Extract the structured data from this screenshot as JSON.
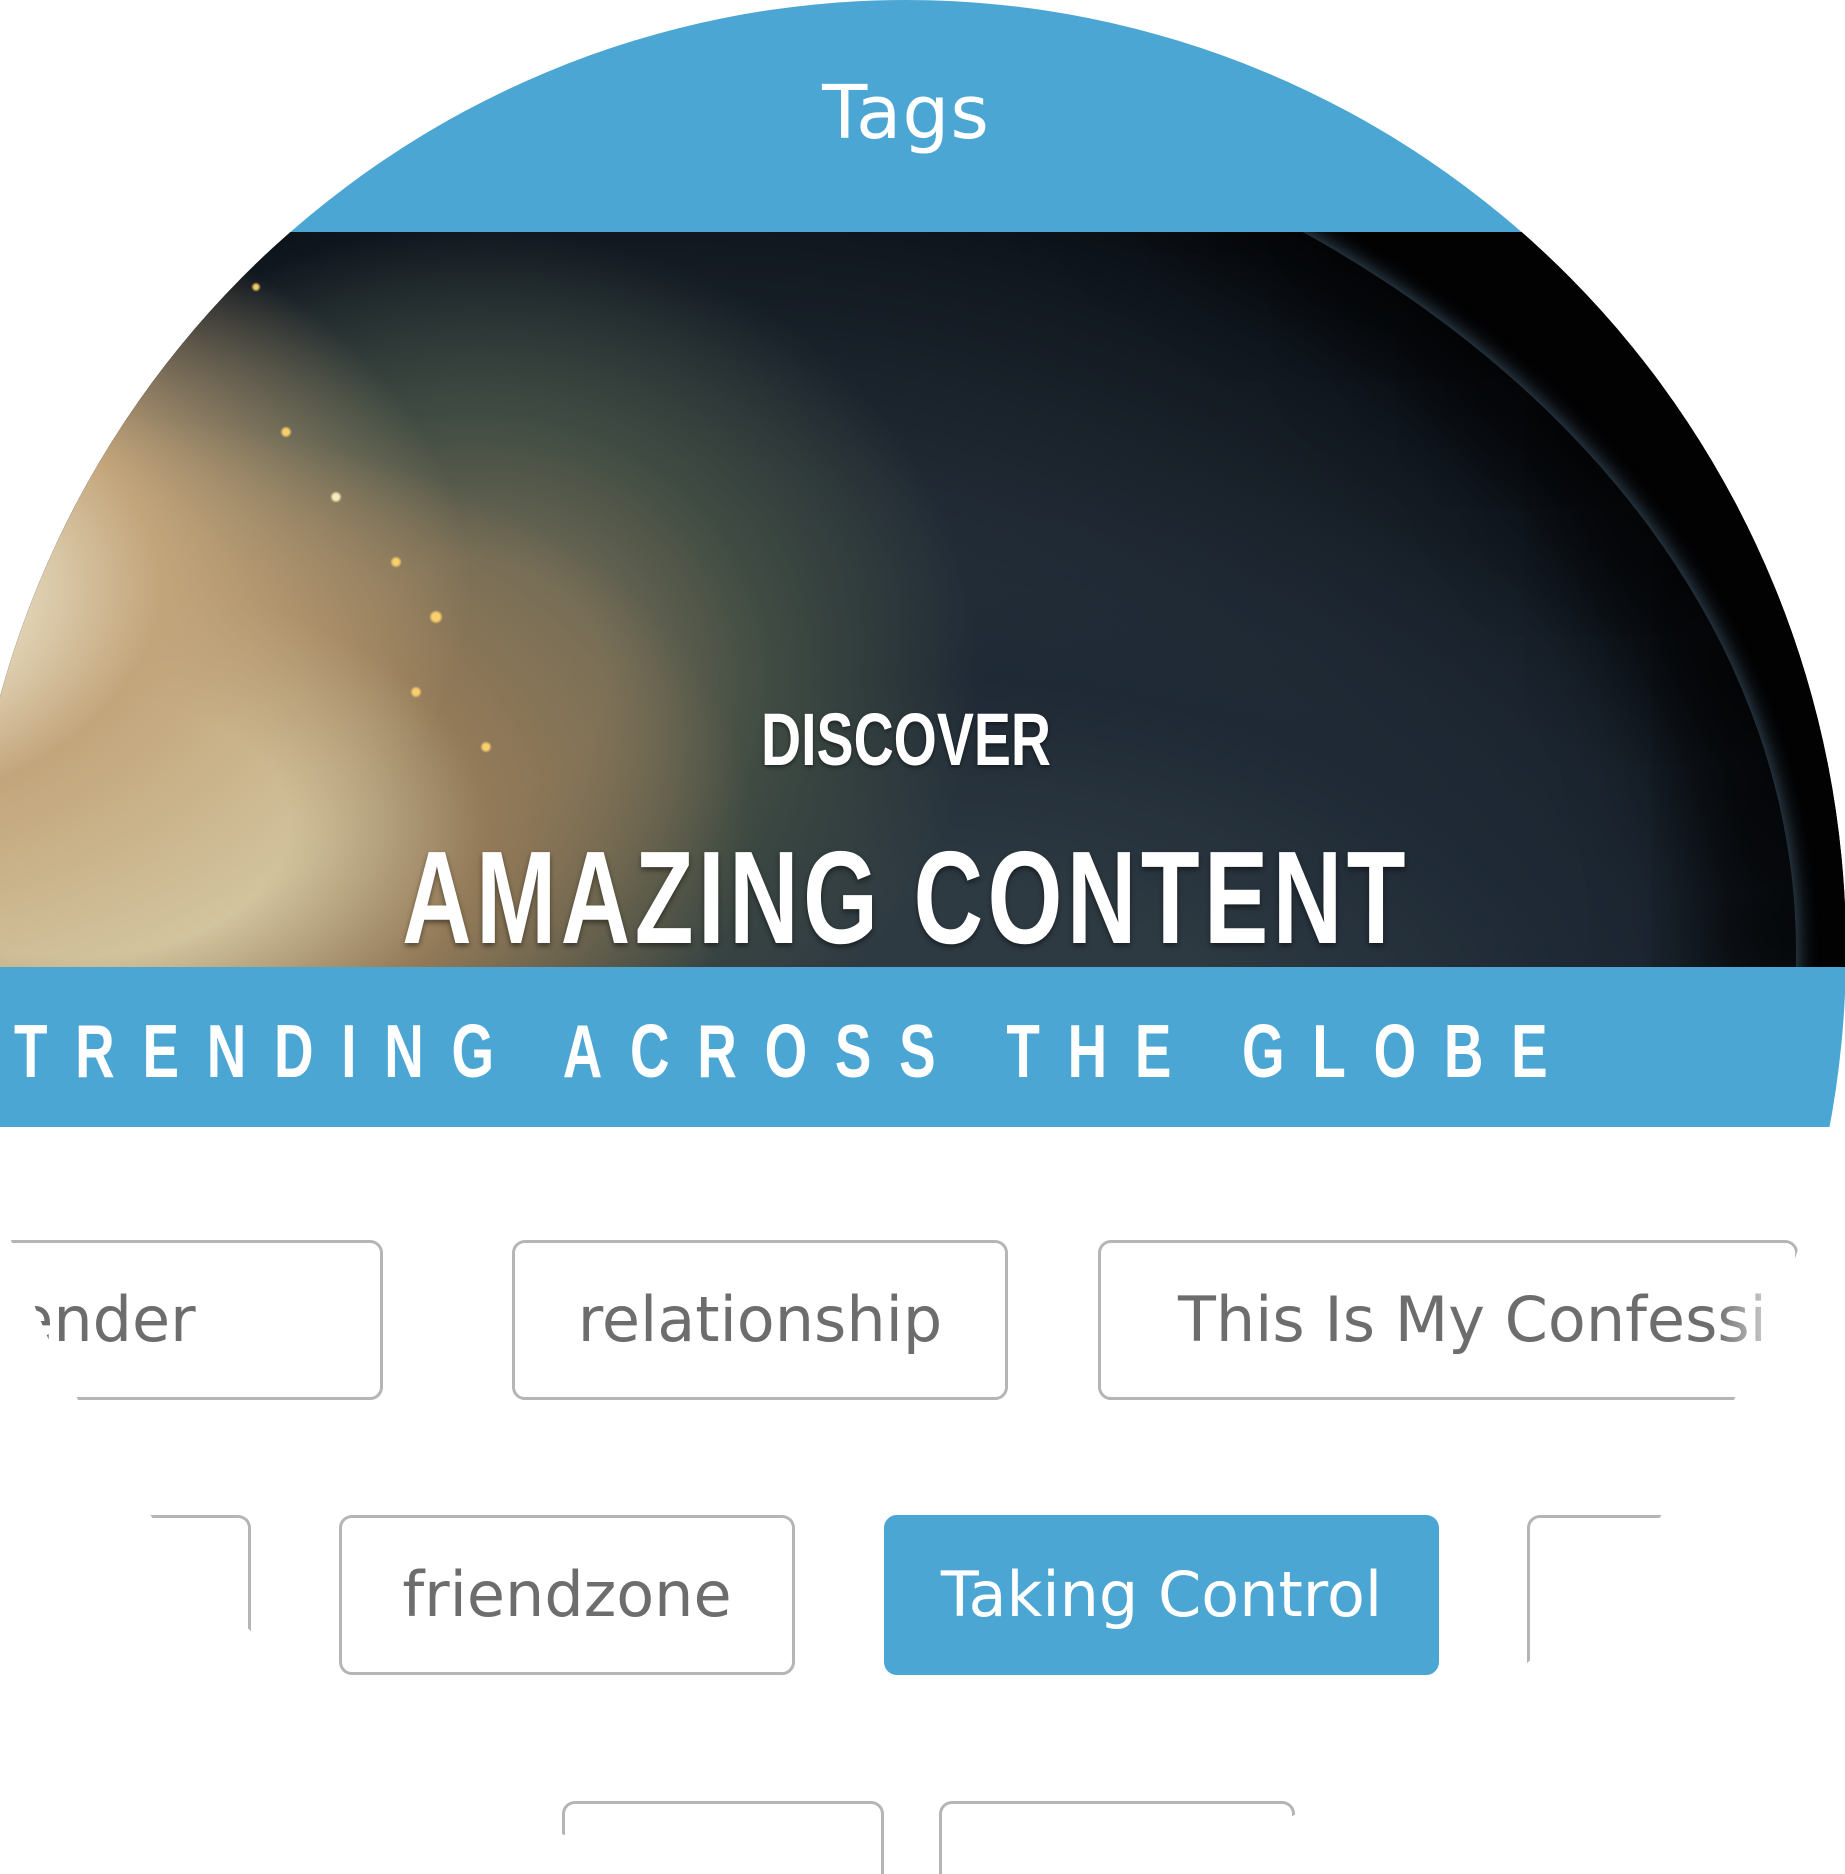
{
  "app": {
    "title": "Tags"
  },
  "hero": {
    "kicker": "DISCOVER",
    "title": "AMAZING CONTENT",
    "image": "earth-at-night-image"
  },
  "trending": {
    "label": "TRENDING ACROSS THE GLOBE"
  },
  "tags": {
    "row1": [
      {
        "label": "Surrender",
        "state": "partially-visible"
      },
      {
        "label": "relationship",
        "state": "default"
      },
      {
        "label": "This Is My Confessi",
        "state": "partially-visible"
      }
    ],
    "row2": [
      {
        "label": "",
        "state": "edge-visible"
      },
      {
        "label": "friendzone",
        "state": "default"
      },
      {
        "label": "Taking Control",
        "state": "selected"
      },
      {
        "label": "",
        "state": "edge-visible"
      }
    ],
    "row3": [
      {
        "label": "",
        "state": "edge-visible"
      },
      {
        "label": "",
        "state": "edge-visible"
      }
    ]
  },
  "colors": {
    "accent": "#4ba6d3",
    "tag_border": "#b5b5b5",
    "tag_text": "#6d6d6d",
    "background": "#ffffff"
  }
}
